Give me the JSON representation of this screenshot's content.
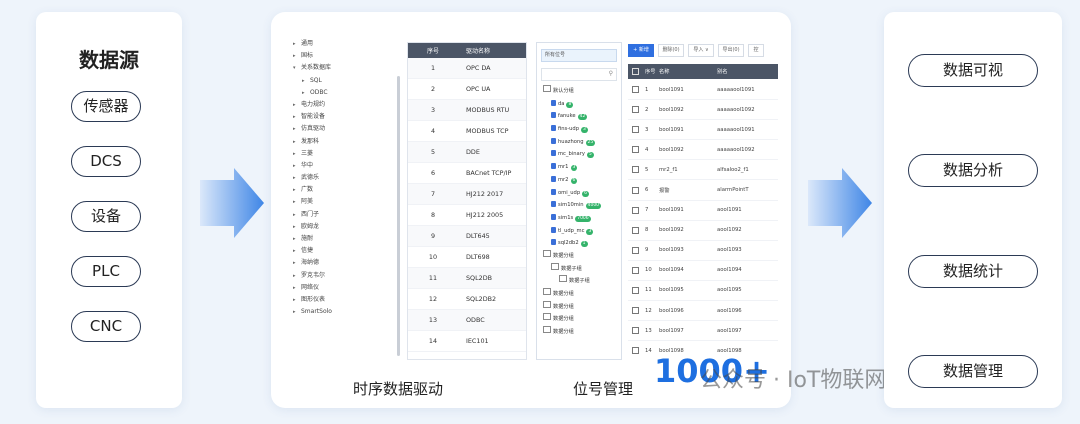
{
  "left": {
    "title": "数据源",
    "items": [
      "传感器",
      "DCS",
      "设备",
      "PLC",
      "CNC"
    ]
  },
  "center": {
    "driver_tree": [
      {
        "label": "通用",
        "indent": 0,
        "arrow": "▸"
      },
      {
        "label": "国标",
        "indent": 0,
        "arrow": "▸"
      },
      {
        "label": "关系数据库",
        "indent": 0,
        "arrow": "▾"
      },
      {
        "label": "SQL",
        "indent": 1,
        "arrow": "▸"
      },
      {
        "label": "ODBC",
        "indent": 1,
        "arrow": "▸"
      },
      {
        "label": "电力规约",
        "indent": 0,
        "arrow": "▸"
      },
      {
        "label": "智能设备",
        "indent": 0,
        "arrow": "▸"
      },
      {
        "label": "仿真驱动",
        "indent": 0,
        "arrow": "▸"
      },
      {
        "label": "发那科",
        "indent": 0,
        "arrow": "▸"
      },
      {
        "label": "三菱",
        "indent": 0,
        "arrow": "▸"
      },
      {
        "label": "华中",
        "indent": 0,
        "arrow": "▸"
      },
      {
        "label": "武德乐",
        "indent": 0,
        "arrow": "▸"
      },
      {
        "label": "广数",
        "indent": 0,
        "arrow": "▸"
      },
      {
        "label": "阿美",
        "indent": 0,
        "arrow": "▸"
      },
      {
        "label": "西门子",
        "indent": 0,
        "arrow": "▸"
      },
      {
        "label": "欧姆龙",
        "indent": 0,
        "arrow": "▸"
      },
      {
        "label": "施耐",
        "indent": 0,
        "arrow": "▸"
      },
      {
        "label": "信捷",
        "indent": 0,
        "arrow": "▸"
      },
      {
        "label": "海纳德",
        "indent": 0,
        "arrow": "▸"
      },
      {
        "label": "罗克韦尔",
        "indent": 0,
        "arrow": "▸"
      },
      {
        "label": "网络仪",
        "indent": 0,
        "arrow": "▸"
      },
      {
        "label": "图形仪表",
        "indent": 0,
        "arrow": "▸"
      },
      {
        "label": "SmartSolo",
        "indent": 0,
        "arrow": "▸"
      }
    ],
    "driver_table": {
      "headers": [
        "序号",
        "驱动名称"
      ],
      "rows": [
        {
          "idx": "1",
          "name": "OPC DA"
        },
        {
          "idx": "2",
          "name": "OPC UA"
        },
        {
          "idx": "3",
          "name": "MODBUS RTU"
        },
        {
          "idx": "4",
          "name": "MODBUS TCP"
        },
        {
          "idx": "5",
          "name": "DDE"
        },
        {
          "idx": "6",
          "name": "BACnet TCP/IP"
        },
        {
          "idx": "7",
          "name": "HJ212 2017"
        },
        {
          "idx": "8",
          "name": "HJ212 2005"
        },
        {
          "idx": "9",
          "name": "DLT645"
        },
        {
          "idx": "10",
          "name": "DLT698"
        },
        {
          "idx": "11",
          "name": "SQL2DB"
        },
        {
          "idx": "12",
          "name": "SQL2DB2"
        },
        {
          "idx": "13",
          "name": "ODBC"
        },
        {
          "idx": "14",
          "name": "IEC101"
        }
      ]
    },
    "tag_tree": {
      "search_label": "所有位号",
      "items": [
        {
          "label": "默认分组",
          "kind": "folder",
          "indent": 0,
          "badge": ""
        },
        {
          "label": "da",
          "kind": "file",
          "indent": 1,
          "badge": "8"
        },
        {
          "label": "fanuke",
          "kind": "file",
          "indent": 1,
          "badge": "42"
        },
        {
          "label": "fins-udp",
          "kind": "file",
          "indent": 1,
          "badge": "3"
        },
        {
          "label": "huazhong",
          "kind": "file",
          "indent": 1,
          "badge": "25"
        },
        {
          "label": "mc_binary",
          "kind": "file",
          "indent": 1,
          "badge": "5"
        },
        {
          "label": "mr1",
          "kind": "file",
          "indent": 1,
          "badge": "3"
        },
        {
          "label": "mr2",
          "kind": "file",
          "indent": 1,
          "badge": "6"
        },
        {
          "label": "omi_udp",
          "kind": "file",
          "indent": 1,
          "badge": "6"
        },
        {
          "label": "sim10min",
          "kind": "file",
          "indent": 1,
          "badge": "4000"
        },
        {
          "label": "sim1s",
          "kind": "file",
          "indent": 1,
          "badge": "7006"
        },
        {
          "label": "tl_udp_mc",
          "kind": "file",
          "indent": 1,
          "badge": "3"
        },
        {
          "label": "sql2db2",
          "kind": "file",
          "indent": 1,
          "badge": "1"
        },
        {
          "label": "数据分组",
          "kind": "folder",
          "indent": 0,
          "badge": ""
        },
        {
          "label": "数据子组",
          "kind": "folder",
          "indent": 1,
          "badge": ""
        },
        {
          "label": "数据子组",
          "kind": "folder",
          "indent": 2,
          "badge": ""
        },
        {
          "label": "数据分组",
          "kind": "folder",
          "indent": 0,
          "badge": ""
        },
        {
          "label": "数据分组",
          "kind": "folder",
          "indent": 0,
          "badge": ""
        },
        {
          "label": "数据分组",
          "kind": "folder",
          "indent": 0,
          "badge": ""
        },
        {
          "label": "数据分组",
          "kind": "folder",
          "indent": 0,
          "badge": ""
        }
      ]
    },
    "tag_toolbar": [
      "+ 新增",
      "删除(0)",
      "导入 ∨",
      "导出(0)",
      "控"
    ],
    "tag_table": {
      "headers": [
        "序号",
        "名称",
        "别名"
      ],
      "rows": [
        {
          "idx": "1",
          "name": "bool1091",
          "addr": "aaaaaool1091"
        },
        {
          "idx": "2",
          "name": "bool1092",
          "addr": "aaaaaool1092"
        },
        {
          "idx": "3",
          "name": "bool1091",
          "addr": "aaaaaool1091"
        },
        {
          "idx": "4",
          "name": "bool1092",
          "addr": "aaaaaool1092"
        },
        {
          "idx": "5",
          "name": "mr2_f1",
          "addr": "alfsaloo2_f1"
        },
        {
          "idx": "6",
          "name": "报警",
          "addr": "alarmPointT"
        },
        {
          "idx": "7",
          "name": "bool1091",
          "addr": "aool1091"
        },
        {
          "idx": "8",
          "name": "bool1092",
          "addr": "aool1092"
        },
        {
          "idx": "9",
          "name": "bool1093",
          "addr": "aool1093"
        },
        {
          "idx": "10",
          "name": "bool1094",
          "addr": "aool1094"
        },
        {
          "idx": "11",
          "name": "bool1095",
          "addr": "aool1095"
        },
        {
          "idx": "12",
          "name": "bool1096",
          "addr": "aool1096"
        },
        {
          "idx": "13",
          "name": "bool1097",
          "addr": "aool1097"
        },
        {
          "idx": "14",
          "name": "bool1098",
          "addr": "aool1098"
        }
      ]
    },
    "caption_driver": "时序数据驱动",
    "caption_tag": "位号管理",
    "tag_count": "1000+",
    "watermark": "公众号 · IoT物联网技术"
  },
  "right": {
    "items": [
      "数据可视",
      "数据分析",
      "数据统计",
      "数据管理"
    ]
  },
  "colors": {
    "accent": "#1e6fe0",
    "arrow": "#3f86e6",
    "badge": "#34b36a",
    "table_header": "#4b5566"
  }
}
